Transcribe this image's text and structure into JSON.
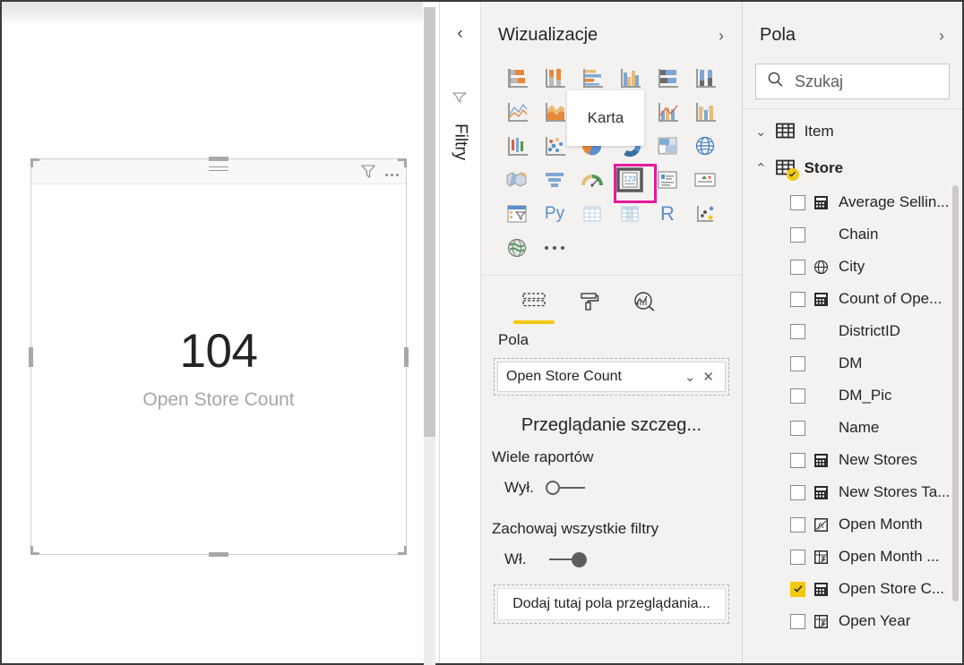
{
  "canvas": {
    "visual": {
      "name": "card-visual",
      "value": "104",
      "label": "Open Store Count",
      "header_icons": [
        "drag-grip",
        "filter-icon",
        "more-options-icon"
      ]
    }
  },
  "filters_rail": {
    "collapse_label": "‹",
    "title": "Filtry",
    "icon": "funnel-icon"
  },
  "visualizations": {
    "title": "Wizualizacje",
    "expand_label": "›",
    "tooltip": "Karta",
    "icons": [
      "stacked-bar-chart",
      "stacked-column-chart",
      "clustered-bar-chart",
      "clustered-column-chart",
      "100-stacked-bar-chart",
      "100-stacked-column-chart",
      "line-chart",
      "area-chart",
      "stacked-area-chart",
      "line-and-stacked-column-chart",
      "line-and-clustered-column-chart",
      "ribbon-chart",
      "waterfall-chart",
      "scatter-chart",
      "pie-chart",
      "donut-chart",
      "treemap-chart",
      "map-globe",
      "filled-map",
      "funnel-chart",
      "gauge-chart",
      "card-visual",
      "multi-row-card",
      "kpi-visual",
      "slicer-visual",
      "python-visual",
      "table-visual",
      "matrix-visual",
      "r-script-visual",
      "key-influencers-visual",
      "arcgis-map",
      "more-visuals-ellipsis"
    ],
    "selected_icon": "card-visual",
    "more_label": "…",
    "tabs": [
      {
        "name": "fields-tab",
        "icon": "fields-icon",
        "active": true
      },
      {
        "name": "format-tab",
        "icon": "paint-roller-icon",
        "active": false
      },
      {
        "name": "analytics-tab",
        "icon": "magnifier-chart-icon",
        "active": false
      }
    ],
    "tab_label": "Pola",
    "field_well": {
      "pill_value": "Open Store Count",
      "dropdown_glyph": "⌄",
      "remove_glyph": "✕"
    },
    "drillthrough": {
      "title": "Przeglądanie szczeg...",
      "option1_label": "Wiele raportów",
      "option1_state": "Wył.",
      "option1_on": false,
      "option2_label": "Zachowaj wszystkie filtry",
      "option2_state": "Wł.",
      "option2_on": true,
      "dropzone_label": "Dodaj tutaj pola przeglądania..."
    }
  },
  "fields": {
    "title": "Pola",
    "expand_label": "›",
    "search_placeholder": "Szukaj",
    "search_value": "",
    "search_icon": "search-icon",
    "tables": [
      {
        "name": "Item",
        "expanded": false,
        "chevron": "⌄",
        "has_check": false,
        "icon": "table-icon",
        "bold": false,
        "fields": []
      },
      {
        "name": "Store",
        "expanded": true,
        "chevron": "⌃",
        "has_check": true,
        "icon": "table-icon",
        "bold": true,
        "fields": [
          {
            "label": "Average Sellin...",
            "icon": "measure-icon",
            "checked": false
          },
          {
            "label": "Chain",
            "icon": "none",
            "checked": false
          },
          {
            "label": "City",
            "icon": "geo-icon",
            "checked": false
          },
          {
            "label": "Count of Ope...",
            "icon": "measure-icon",
            "checked": false
          },
          {
            "label": "DistrictID",
            "icon": "none",
            "checked": false
          },
          {
            "label": "DM",
            "icon": "none",
            "checked": false
          },
          {
            "label": "DM_Pic",
            "icon": "none",
            "checked": false
          },
          {
            "label": "Name",
            "icon": "none",
            "checked": false
          },
          {
            "label": "New Stores",
            "icon": "measure-icon",
            "checked": false
          },
          {
            "label": "New Stores Ta...",
            "icon": "measure-icon",
            "checked": false
          },
          {
            "label": "Open Month",
            "icon": "calculated-column-icon",
            "checked": false
          },
          {
            "label": "Open Month ...",
            "icon": "hierarchy-icon",
            "checked": false
          },
          {
            "label": "Open Store C...",
            "icon": "measure-icon",
            "checked": true
          },
          {
            "label": "Open Year",
            "icon": "hierarchy-icon",
            "checked": false
          }
        ]
      }
    ]
  },
  "colors": {
    "accent_yellow": "#f2c811",
    "selection_magenta": "#e8199a",
    "pane_bg": "#f3f2f1",
    "text": "#252423",
    "muted_text": "#a6a6a6"
  }
}
